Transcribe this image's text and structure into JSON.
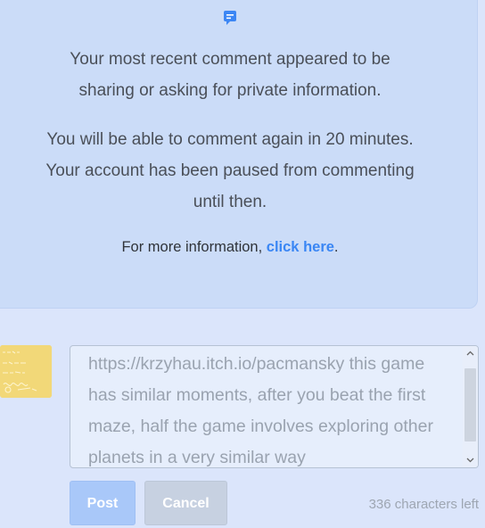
{
  "notice": {
    "icon": "comment-icon",
    "line1": "Your most recent comment appeared to be sharing or asking for private information.",
    "line2": "You will be able to comment again in 20 minutes. Your account has been paused from commenting until then.",
    "more_prefix": "For more information, ",
    "more_link": "click here",
    "more_suffix": "."
  },
  "avatar": {
    "icon": "avatar-image"
  },
  "comment": {
    "value": "https://krzyhau.itch.io/pacmansky this game has similar moments, after you beat the first maze, half the game involves exploring other planets in a very similar way"
  },
  "actions": {
    "post_label": "Post",
    "cancel_label": "Cancel"
  },
  "char_counter": "336 characters left",
  "colors": {
    "background": "#dbe5fb",
    "notice_bg": "#cbdcf8",
    "link": "#3a86f4",
    "post_button": "#a9c8f9",
    "cancel_button": "#c7d1e1"
  }
}
